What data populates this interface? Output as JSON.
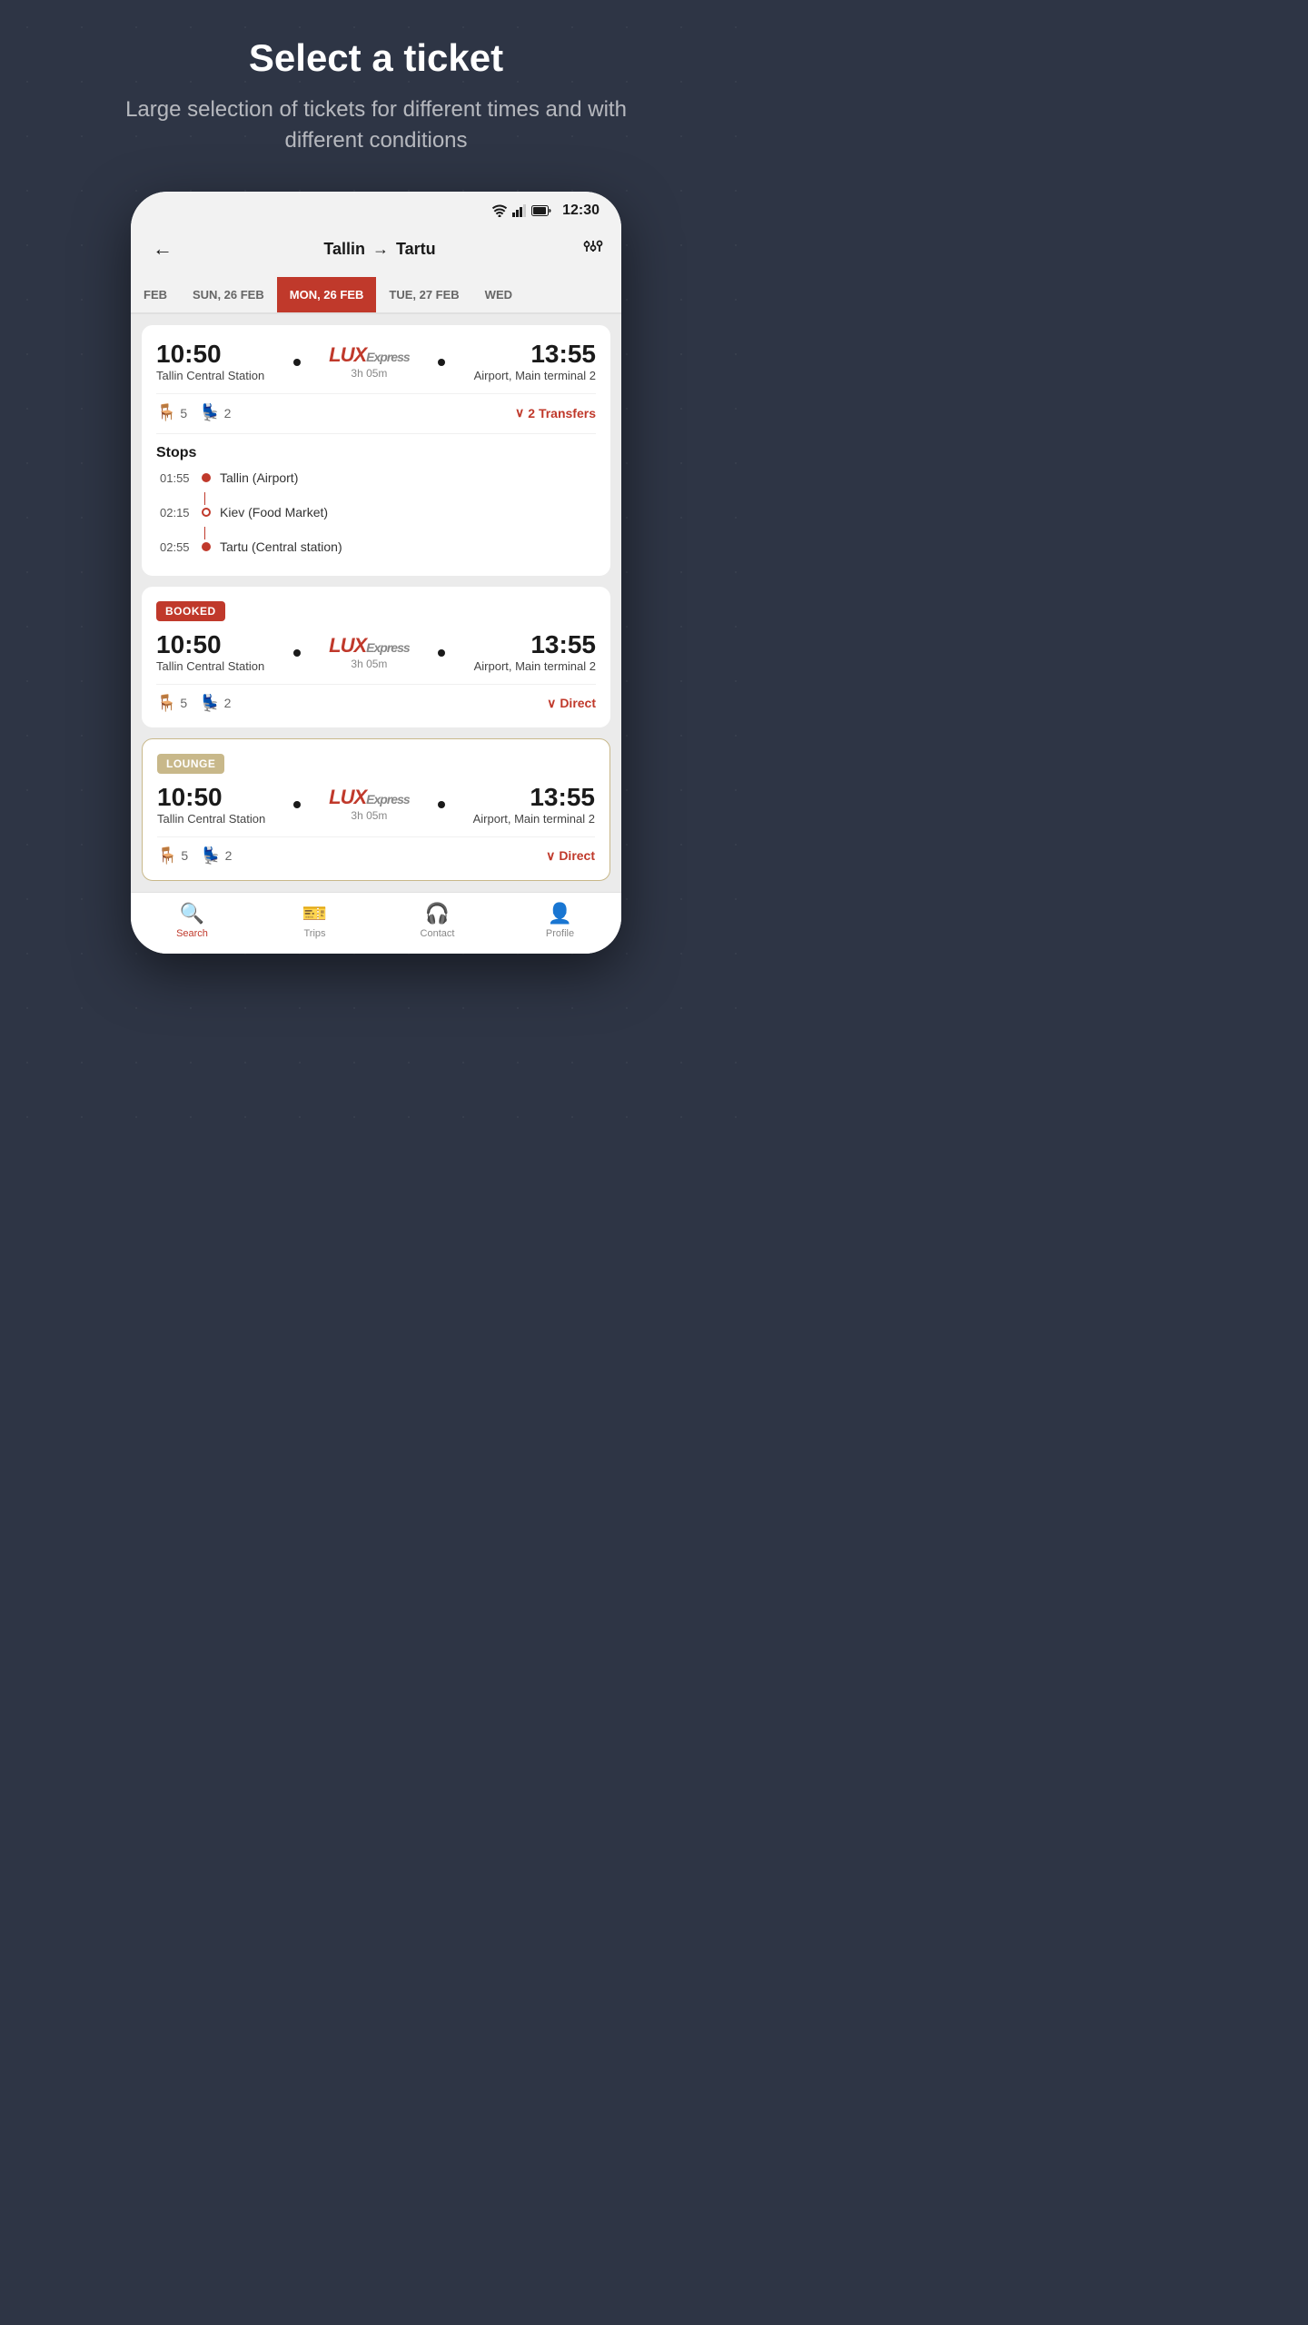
{
  "hero": {
    "title": "Select a ticket",
    "subtitle": "Large selection of tickets for different times and with different conditions"
  },
  "statusBar": {
    "time": "12:30"
  },
  "nav": {
    "backLabel": "←",
    "routeFrom": "Tallin",
    "routeTo": "Tartu",
    "filterIcon": "⚙"
  },
  "dateTabs": [
    {
      "label": "FEB",
      "active": false
    },
    {
      "label": "SUN, 26 FEB",
      "active": false
    },
    {
      "label": "MON, 26 FEB",
      "active": true
    },
    {
      "label": "TUE, 27 FEB",
      "active": false
    },
    {
      "label": "WED",
      "active": false
    }
  ],
  "tickets": [
    {
      "id": "ticket1",
      "badge": null,
      "departTime": "10:50",
      "departStation": "Tallin Central Station",
      "arriveTime": "13:55",
      "arriveStation": "Airport, Main terminal 2",
      "duration": "3h 05m",
      "seat1": "5",
      "seat2": "2",
      "transferLabel": "2 Transfers",
      "isExpanded": true,
      "stops": [
        {
          "time": "01:55",
          "name": "Tallin (Airport)",
          "type": "filled"
        },
        {
          "time": "02:15",
          "name": "Kiev (Food Market)",
          "type": "empty"
        },
        {
          "time": "02:55",
          "name": "Tartu (Central station)",
          "type": "filled"
        }
      ]
    },
    {
      "id": "ticket2",
      "badge": "BOOKED",
      "badgeType": "booked",
      "departTime": "10:50",
      "departStation": "Tallin Central Station",
      "arriveTime": "13:55",
      "arriveStation": "Airport, Main terminal 2",
      "duration": "3h 05m",
      "seat1": "5",
      "seat2": "2",
      "transferLabel": "Direct",
      "isExpanded": false,
      "stops": []
    },
    {
      "id": "ticket3",
      "badge": "LOUNGE",
      "badgeType": "lounge",
      "departTime": "10:50",
      "departStation": "Tallin Central Station",
      "arriveTime": "13:55",
      "arriveStation": "Airport, Main terminal 2",
      "duration": "3h 05m",
      "seat1": "5",
      "seat2": "2",
      "transferLabel": "Direct",
      "isExpanded": false,
      "stops": []
    }
  ],
  "bottomNav": [
    {
      "id": "search",
      "label": "Search",
      "icon": "🔍",
      "active": true
    },
    {
      "id": "trips",
      "label": "Trips",
      "icon": "🎫",
      "active": false
    },
    {
      "id": "contact",
      "label": "Contact",
      "icon": "🎧",
      "active": false
    },
    {
      "id": "profile",
      "label": "Profile",
      "icon": "👤",
      "active": false
    }
  ],
  "colors": {
    "accent": "#c0392b",
    "lounge": "#c8b88a",
    "background": "#2e3545"
  }
}
